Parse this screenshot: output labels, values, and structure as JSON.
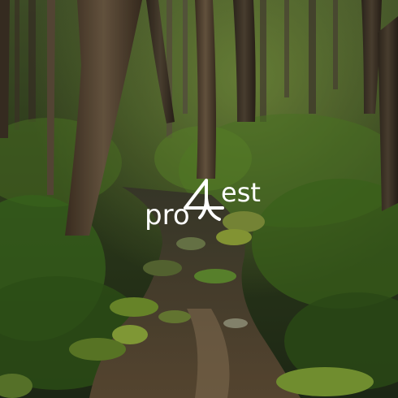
{
  "logo": {
    "left_text": "pro",
    "glyph": "4",
    "right_text": "est",
    "color": "#ffffff"
  },
  "palette": {
    "deep_forest": "#1f2a16",
    "moss": "#6f8f2c",
    "fern": "#4f7a24",
    "bark": "#4a3a2a",
    "water": "#5a4a36",
    "stone": "#7e8061"
  }
}
